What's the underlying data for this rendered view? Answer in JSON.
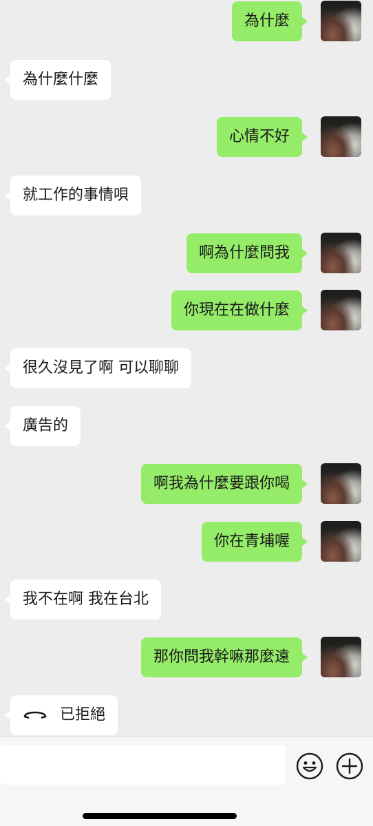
{
  "messages": [
    {
      "side": "out",
      "text": "為什麼"
    },
    {
      "side": "in",
      "text": "為什麼什麼"
    },
    {
      "side": "out",
      "text": "心情不好"
    },
    {
      "side": "in",
      "text": "就工作的事情唄"
    },
    {
      "side": "out",
      "text": "啊為什麼問我"
    },
    {
      "side": "out",
      "text": "你現在在做什麼"
    },
    {
      "side": "in",
      "text": "很久沒見了啊 可以聊聊"
    },
    {
      "side": "in",
      "text": "廣告的"
    },
    {
      "side": "out",
      "text": "啊我為什麼要跟你喝"
    },
    {
      "side": "out",
      "text": "你在青埔喔"
    },
    {
      "side": "in",
      "text": "我不在啊 我在台北"
    },
    {
      "side": "out",
      "text": "那你問我幹嘛那麼遠"
    },
    {
      "side": "in",
      "text": "已拒絕",
      "icon": "declined-call-icon"
    }
  ],
  "input_bar": {
    "value": "",
    "emoji_icon": "emoji-icon",
    "plus_icon": "plus-icon"
  },
  "colors": {
    "background": "#ededed",
    "outgoing_bubble": "#95ec69",
    "incoming_bubble": "#ffffff",
    "text": "#191919"
  }
}
